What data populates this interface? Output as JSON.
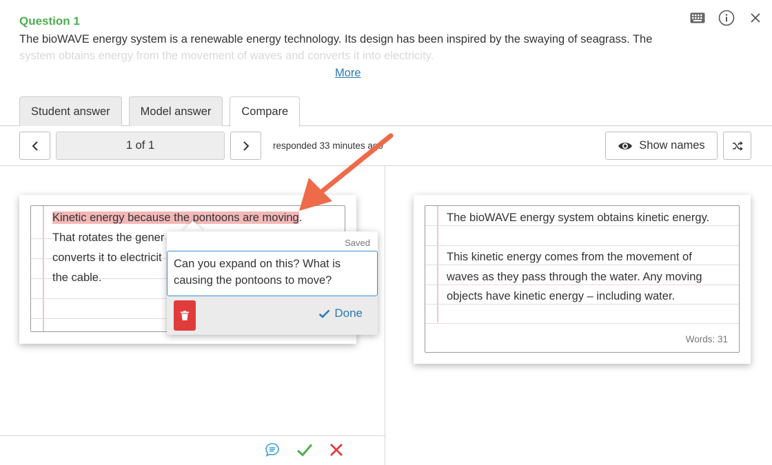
{
  "question": {
    "title": "Question 1",
    "text_line1": "The bioWAVE energy system is a renewable energy technology. Its design has been inspired by the swaying of seagrass. The",
    "text_line2": "system obtains energy from the movement of waves and converts it into electricity.",
    "more_label": "More"
  },
  "top_icons": [
    "keyboard-icon",
    "info-icon",
    "close-icon"
  ],
  "tabs": [
    {
      "label": "Student answer",
      "active": false
    },
    {
      "label": "Model answer",
      "active": false
    },
    {
      "label": "Compare",
      "active": true
    }
  ],
  "toolbar": {
    "page_indicator": "1 of 1",
    "responded": "responded 33 minutes ago",
    "show_names_label": "Show names"
  },
  "student_answer": {
    "highlight": "Kinetic energy because the pontoons are moving",
    "line1_rest": ".",
    "line2": "That rotates the gener",
    "line3": "converts it to electricit",
    "line4": "the cable."
  },
  "comment": {
    "status": "Saved",
    "text": "Can you expand on this? What is causing the pontoons to move?",
    "done_label": "Done"
  },
  "model_answer": {
    "lines": [
      "The bioWAVE energy system obtains kinetic energy.",
      "",
      "This kinetic energy comes from the movement of",
      "waves as they pass through the water. Any moving",
      "objects have kinetic energy – including water."
    ],
    "word_count": "Words: 31"
  },
  "colors": {
    "accent": "#2a7ab0",
    "question_title": "#4caf50",
    "highlight": "#f4b8b8",
    "delete": "#e03c3c",
    "approve": "#4caf50",
    "reject": "#e03c3c",
    "arrow": "#ee6a4a"
  },
  "bottom_icons": [
    "comment-icon",
    "check-icon",
    "cross-icon"
  ]
}
